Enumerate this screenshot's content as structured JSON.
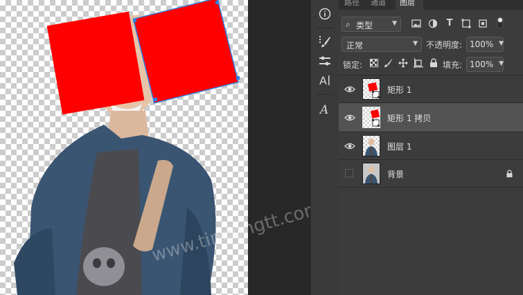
{
  "canvas": {
    "watermark": "www.tingongtt.com",
    "shape_color": "#ff0000"
  },
  "panel": {
    "tabs": [
      {
        "label": "路径"
      },
      {
        "label": "通道"
      },
      {
        "label": "图层"
      }
    ],
    "filter": {
      "label": "类型"
    },
    "blend_mode": {
      "value": "正常"
    },
    "opacity": {
      "label": "不透明度:",
      "value": "100%"
    },
    "lock": {
      "label": "锁定:"
    },
    "fill": {
      "label": "填充:",
      "value": "100%"
    },
    "layers": [
      {
        "name": "矩形 1",
        "visible": true,
        "selected": false,
        "thumb": "rect-red"
      },
      {
        "name": "矩形 1 拷贝",
        "visible": true,
        "selected": true,
        "thumb": "rect-red"
      },
      {
        "name": "图层 1",
        "visible": true,
        "selected": false,
        "thumb": "photo"
      },
      {
        "name": "背景",
        "visible": false,
        "selected": false,
        "thumb": "photo",
        "locked": true
      }
    ]
  },
  "toolbar": {
    "tools": [
      "info-icon",
      "brush-settings-icon",
      "adjust-icon",
      "character-icon",
      "glyph-icon"
    ]
  },
  "colors": {
    "panel_bg": "#3c3c3c",
    "selected_layer": "#535353",
    "accent_blue": "#2f7fdf"
  }
}
